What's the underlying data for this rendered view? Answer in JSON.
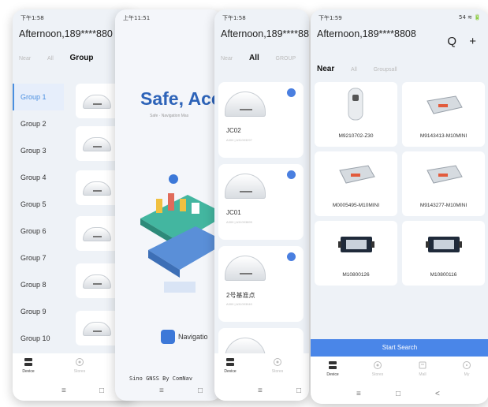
{
  "screen1": {
    "status_time": "下午1:58",
    "greeting": "Afternoon,189****880",
    "tabs": [
      "Near",
      "All",
      "Group"
    ],
    "groups": [
      "Group 1",
      "Group 2",
      "Group 3",
      "Group 4",
      "Group 5",
      "Group 6",
      "Group 7",
      "Group 8",
      "Group 9",
      "Group 10"
    ],
    "nav": [
      "Device",
      "Stores"
    ]
  },
  "screen2": {
    "status_time": "上午11:51",
    "title": "Safe, Acc",
    "subtitle": "Safe · Navigation Mas",
    "nav_label": "Navigatio",
    "brand": "Sino GNSS By ComNav"
  },
  "screen3": {
    "status_time": "下午1:58",
    "greeting": "Afternoon,189****88",
    "tabs": [
      "Near",
      "All",
      "GROUP"
    ],
    "devices": [
      {
        "name": "JC02",
        "id": "A300 | A31003297"
      },
      {
        "name": "JC01",
        "id": "A300 | A31003899"
      },
      {
        "name": "2号基准点",
        "id": "A300 | A31003040"
      }
    ],
    "nav": [
      "Device",
      "Stores"
    ]
  },
  "screen4": {
    "status_time": "下午1:59",
    "status_right": "54 ≋ 🔋",
    "greeting": "Afternoon,189****8808",
    "tabs": [
      "Near",
      "All",
      "Groupsall"
    ],
    "devices": [
      "M9210702-Z30",
      "M9143413-M10MINI",
      "M0005495-M10MINI",
      "M9143277-M10MINI",
      "M10800126",
      "M10800116"
    ],
    "search_label": "Start Search",
    "nav": [
      "Device",
      "Stores",
      "Mall",
      "My"
    ]
  },
  "icons": {
    "search": "Q",
    "add": "+",
    "home_key": "□",
    "menu_key": "≡",
    "back_key": "<"
  }
}
